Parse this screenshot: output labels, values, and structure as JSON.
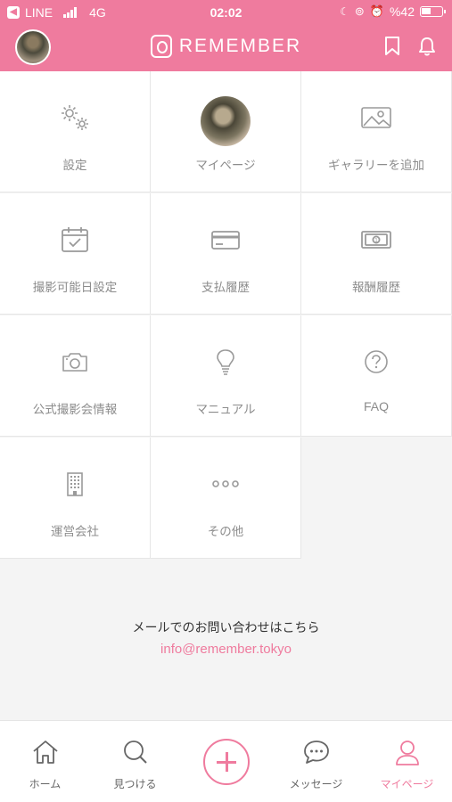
{
  "status_bar": {
    "back_app": "LINE",
    "network": "4G",
    "time": "02:02",
    "battery": "%42"
  },
  "header": {
    "brand": "REMEMBER"
  },
  "menu": {
    "settings": "設定",
    "mypage": "マイページ",
    "add_gallery": "ギャラリーを追加",
    "shoot_schedule": "撮影可能日設定",
    "payment_history": "支払履歴",
    "reward_history": "報酬履歴",
    "official_events": "公式撮影会情報",
    "manual": "マニュアル",
    "faq": "FAQ",
    "company": "運営会社",
    "others": "その他"
  },
  "contact": {
    "text": "メールでのお問い合わせはこちら",
    "email": "info@remember.tokyo"
  },
  "tabbar": {
    "home": "ホーム",
    "discover": "見つける",
    "messages": "メッセージ",
    "mypage": "マイページ"
  },
  "colors": {
    "brand_pink": "#ef7b9e",
    "icon_gray": "#9a9a9a"
  }
}
